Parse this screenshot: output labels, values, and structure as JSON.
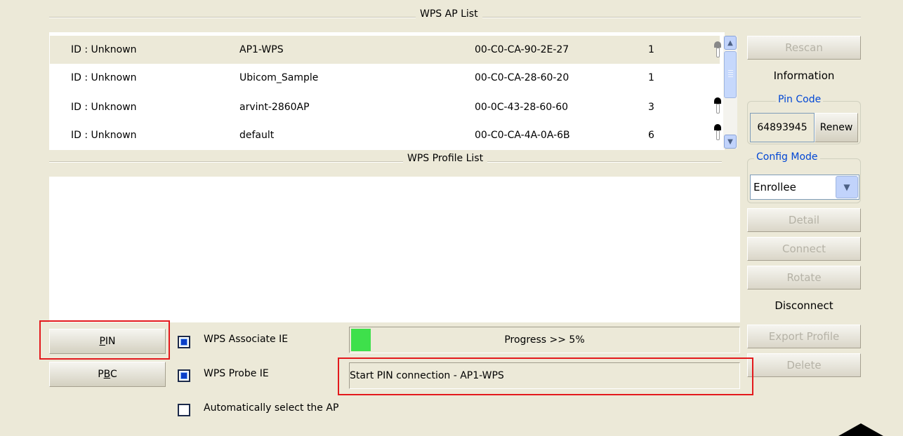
{
  "ap_list": {
    "title": "WPS AP List",
    "rows": [
      {
        "id": "ID : Unknown",
        "ssid": "AP1-WPS",
        "bssid": "00-C0-CA-90-2E-27",
        "channel": "1",
        "lock": "grey-lock-icon"
      },
      {
        "id": "ID : Unknown",
        "ssid": "Ubicom_Sample",
        "bssid": "00-C0-CA-28-60-20",
        "channel": "1",
        "lock": ""
      },
      {
        "id": "ID : Unknown",
        "ssid": "arvint-2860AP",
        "bssid": "00-0C-43-28-60-60",
        "channel": "3",
        "lock": "lock-icon"
      },
      {
        "id": "ID : Unknown",
        "ssid": "default",
        "bssid": "00-C0-CA-4A-0A-6B",
        "channel": "6",
        "lock": "lock-icon"
      }
    ]
  },
  "profile_list": {
    "title": "WPS Profile List"
  },
  "right_panel": {
    "rescan": "Rescan",
    "information": "Information",
    "pin_code_legend": "Pin Code",
    "pin_code_value": "64893945",
    "renew": "Renew",
    "config_mode_legend": "Config Mode",
    "config_mode_value": "Enrollee",
    "detail": "Detail",
    "connect": "Connect",
    "rotate": "Rotate",
    "disconnect": "Disconnect",
    "export_profile": "Export Profile",
    "delete": "Delete"
  },
  "bottom": {
    "pin_button_prefix": "",
    "pin_button_mnemonic": "P",
    "pin_button_rest": "IN",
    "pbc_button_prefix": "P",
    "pbc_button_mnemonic": "B",
    "pbc_button_rest": "C",
    "wps_associate_ie": "WPS Associate IE",
    "wps_probe_ie": "WPS Probe IE",
    "auto_select": "Automatically select the AP",
    "progress_text": "Progress >> 5%",
    "progress_fraction": 0.05,
    "status_text": "Start PIN connection - AP1-WPS"
  },
  "colors": {
    "background": "#ece9d8",
    "progress_fill": "#3ee04b",
    "highlight_box": "#e3191c",
    "legend_text": "#0046d5"
  }
}
